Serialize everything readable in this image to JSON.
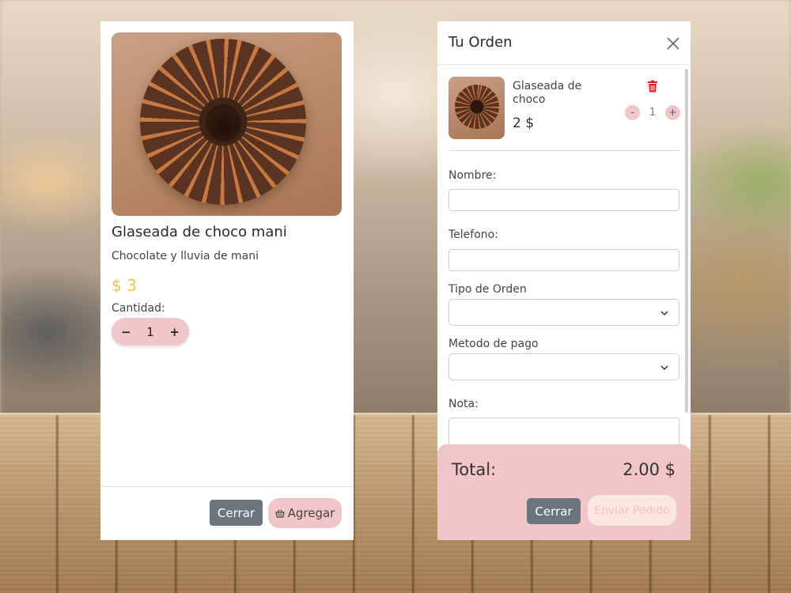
{
  "product": {
    "name": "Glaseada de choco mani",
    "description": "Chocolate y lluvia de mani",
    "price": "$ 3",
    "quantity_label": "Cantidad:",
    "quantity": "1",
    "minus": "−",
    "plus": "+",
    "close_label": "Cerrar",
    "add_label": "Agregar",
    "add_icon": "basket-icon"
  },
  "order": {
    "title": "Tu Orden",
    "close_icon": "close-icon",
    "item": {
      "name": "Glaseada de choco",
      "price": "2 $",
      "quantity": "1",
      "minus": "-",
      "plus": "+",
      "delete_icon": "trash-icon"
    },
    "form": {
      "nombre_label": "Nombre:",
      "telefono_label": "Telefono:",
      "tipo_label": "Tipo de Orden",
      "metodo_label": "Metodo de pago",
      "nota_label": "Nota:"
    },
    "total_label": "Total:",
    "total_value": "2.00 $",
    "close_label": "Cerrar",
    "send_label": "Enviar Pedido"
  },
  "colors": {
    "accent_pink": "#f0c6c8",
    "price_gold": "#f0c24a",
    "button_gray": "#6c757d",
    "delete_red": "#e02020"
  }
}
